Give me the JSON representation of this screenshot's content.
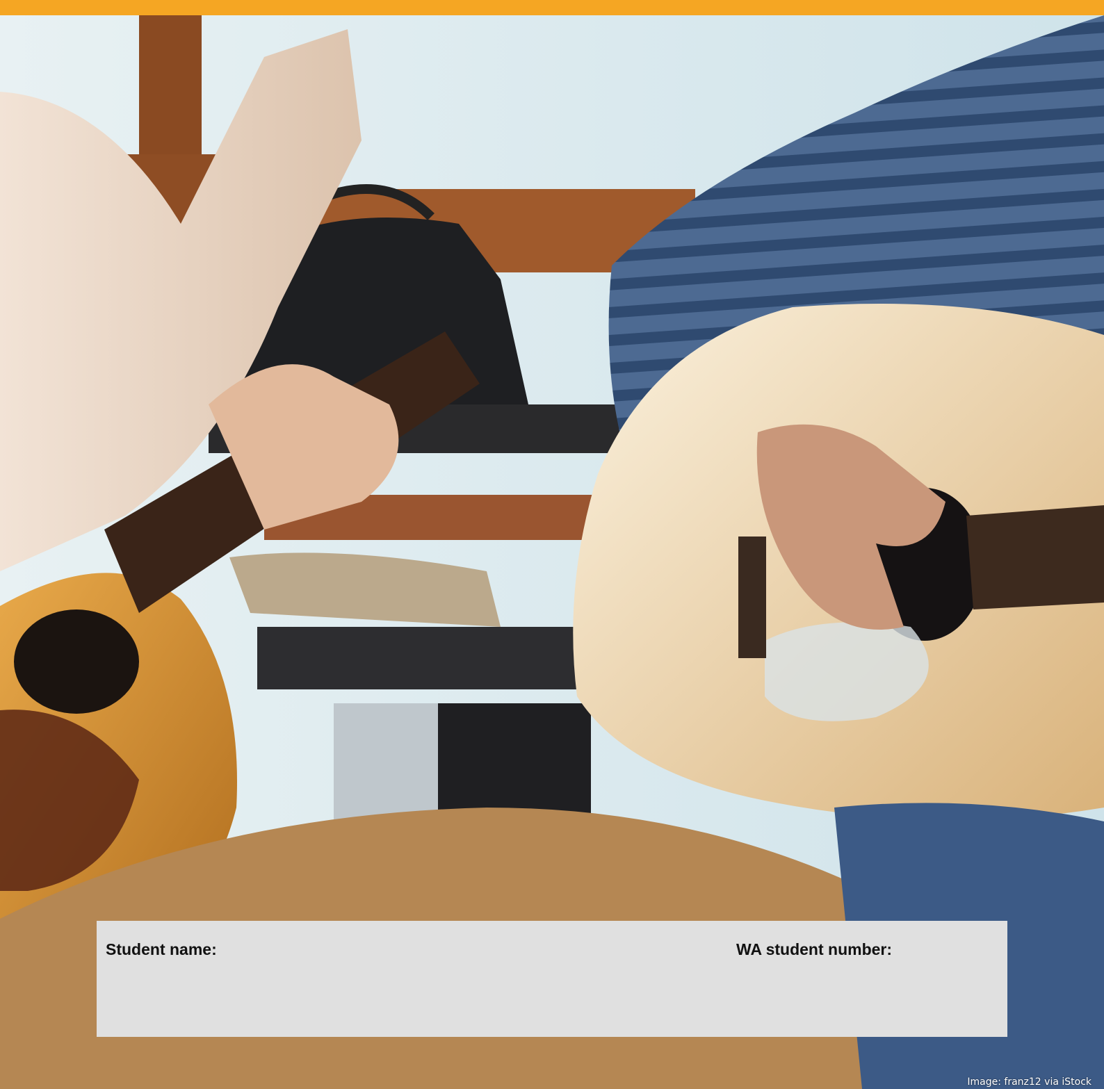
{
  "header": {
    "bar_color": "#f5a623"
  },
  "photo": {
    "subject": "two-people-playing-acoustic-guitars"
  },
  "form": {
    "student_name_label": "Student name:",
    "student_number_label": "WA student number:",
    "panel_color": "#e0e0e0"
  },
  "credit": {
    "text": "Image: franz12 via iStock"
  }
}
